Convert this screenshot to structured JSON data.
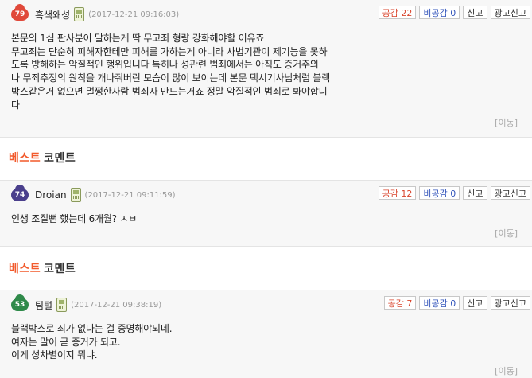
{
  "comments": [
    {
      "level": "79",
      "level_color": "#e0493a",
      "nickname": "흑색왜성",
      "date": "(2017-12-21 09:16:03)",
      "like_label": "공감 22",
      "dislike_label": "비공감 0",
      "report_label": "신고",
      "ad_report_label": "광고신고",
      "body": "본문의 1심 판사분이 말하는게 딱 무고죄 형량 강화해야할 이유죠\n무고죄는 단순히 피해자한테만 피해를 가하는게 아니라 사법기관이 제기능을 못하\n도록 방해하는 악질적인 행위입니다 특히나 성관련 범죄에서는 아직도 증거주의\n나 무죄추정의 원칙을 개나줘버린 모습이 많이 보이는데 본문 택시기사님처럼 블랙\n박스같은거 없으면 멀쩡한사람 범죄자 만드는거죠 정말 악질적인 범죄로 봐야합니\n다",
      "move_label": "[이동]"
    },
    {
      "level": "74",
      "level_color": "#4a3f8c",
      "nickname": "Droian",
      "date": "(2017-12-21 09:11:59)",
      "like_label": "공감 12",
      "dislike_label": "비공감 0",
      "report_label": "신고",
      "ad_report_label": "광고신고",
      "body": "인생 조질뻔 했는데 6개월? ㅅㅂ",
      "move_label": "[이동]"
    },
    {
      "level": "53",
      "level_color": "#2f8a4a",
      "nickname": "팀털",
      "date": "(2017-12-21 09:38:19)",
      "like_label": "공감 7",
      "dislike_label": "비공감 0",
      "report_label": "신고",
      "ad_report_label": "광고신고",
      "body": "블랙박스로 죄가 없다는 걸 증명해야되네.\n여자는 말이 곧 증거가 되고.\n이게 성차별이지 뭐냐.",
      "move_label": "[이동]"
    }
  ],
  "best_label_a": "베스트",
  "best_label_b": "코멘트"
}
